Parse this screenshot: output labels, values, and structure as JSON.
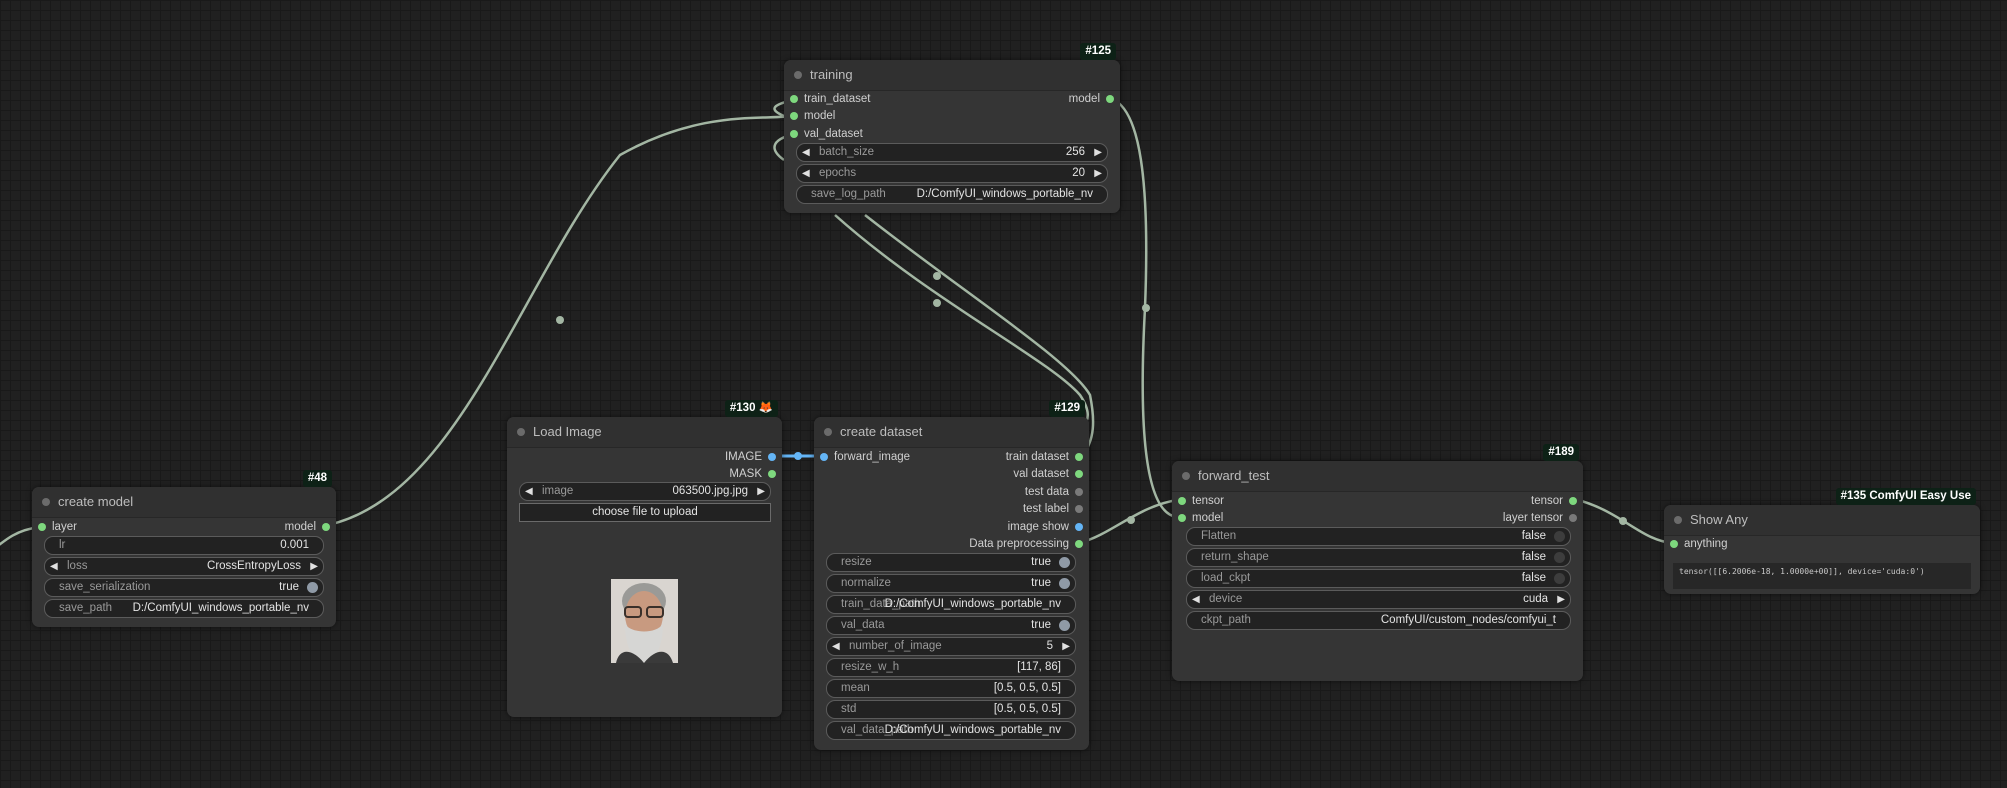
{
  "nodes": {
    "training": {
      "id": "#125",
      "title": "training",
      "inputs": [
        "train_dataset",
        "model",
        "val_dataset"
      ],
      "outputs": [
        "model"
      ],
      "widgets": {
        "batch_size": {
          "label": "batch_size",
          "value": "256"
        },
        "epochs": {
          "label": "epochs",
          "value": "20"
        },
        "save_log_path": {
          "label": "save_log_path",
          "value": "D:/ComfyUI_windows_portable_nv"
        }
      }
    },
    "create_model": {
      "id": "#48",
      "title": "create model",
      "inputs": [
        "layer"
      ],
      "outputs": [
        "model"
      ],
      "widgets": {
        "lr": {
          "label": "lr",
          "value": "0.001"
        },
        "loss": {
          "label": "loss",
          "value": "CrossEntropyLoss"
        },
        "save_serialization": {
          "label": "save_serialization",
          "value": "true"
        },
        "save_path": {
          "label": "save_path",
          "value": "D:/ComfyUI_windows_portable_nv"
        }
      }
    },
    "load_image": {
      "id": "#130 🦊",
      "title": "Load Image",
      "outputs": [
        "IMAGE",
        "MASK"
      ],
      "widgets": {
        "image": {
          "label": "image",
          "value": "063500.jpg.jpg"
        },
        "upload": {
          "label": "choose file to upload"
        }
      }
    },
    "create_dataset": {
      "id": "#129",
      "title": "create dataset",
      "inputs": [
        "forward_image"
      ],
      "outputs": [
        "train dataset",
        "val dataset",
        "test data",
        "test label",
        "image show",
        "Data preprocessing"
      ],
      "widgets": {
        "resize": {
          "label": "resize",
          "value": "true"
        },
        "normalize": {
          "label": "normalize",
          "value": "true"
        },
        "train_data_path": {
          "label": "train_data_path",
          "value": "D:/ComfyUI_windows_portable_nv"
        },
        "val_data": {
          "label": "val_data",
          "value": "true"
        },
        "number_of_image": {
          "label": "number_of_image",
          "value": "5"
        },
        "resize_w_h": {
          "label": "resize_w_h",
          "value": "[117, 86]"
        },
        "mean": {
          "label": "mean",
          "value": "[0.5, 0.5, 0.5]"
        },
        "std": {
          "label": "std",
          "value": "[0.5, 0.5, 0.5]"
        },
        "val_data_path": {
          "label": "val_data_path",
          "value": "D:/ComfyUI_windows_portable_nv"
        }
      }
    },
    "forward_test": {
      "id": "#189",
      "title": "forward_test",
      "inputs": [
        "tensor",
        "model"
      ],
      "outputs": [
        "tensor",
        "layer tensor"
      ],
      "widgets": {
        "flatten": {
          "label": "Flatten",
          "value": "false"
        },
        "return_shape": {
          "label": "return_shape",
          "value": "false"
        },
        "load_ckpt": {
          "label": "load_ckpt",
          "value": "false"
        },
        "device": {
          "label": "device",
          "value": "cuda"
        },
        "ckpt_path": {
          "label": "ckpt_path",
          "value": "ComfyUI/custom_nodes/comfyui_t"
        }
      }
    },
    "show_any": {
      "id": "#135 ComfyUI Easy Use",
      "title": "Show Any",
      "inputs": [
        "anything"
      ],
      "text": "tensor([[6.2006e-18, 1.0000e+00]], device='cuda:0')"
    }
  },
  "colors": {
    "background": "#202020",
    "node_body": "#353535",
    "node_title": "#303030",
    "link": "#a3b6a3",
    "slot_green": "#7ed87e",
    "slot_blue": "#64b5f6",
    "badge": "#0d2116"
  }
}
